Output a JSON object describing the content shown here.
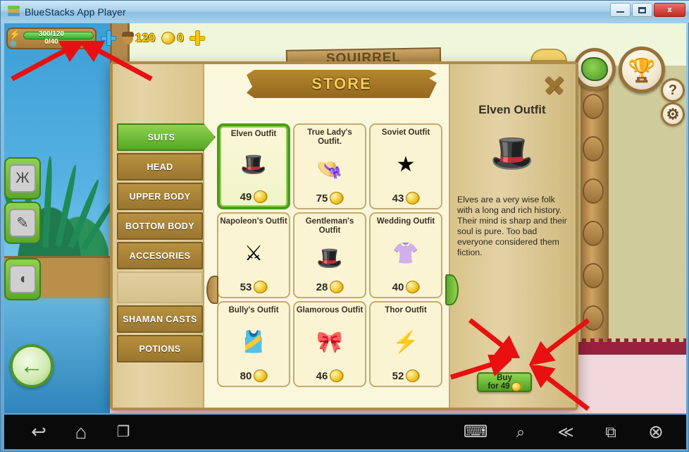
{
  "window": {
    "title": "BlueStacks App Player",
    "logo_icon": "bluestacks-logo",
    "minimize_label": "",
    "maximize_label": "",
    "close_label": "x"
  },
  "hud": {
    "energy_top": "300/120",
    "energy_bottom": "0/40",
    "acorn_count": "120",
    "coin_count": "0",
    "add_energy_icon": "blue-plus-icon",
    "add_coins_icon": "gold-plus-icon"
  },
  "game_banner": "SQUIRREL",
  "side_buttons": {
    "map_icon": "map-island-icon",
    "trophy_icon": "trophy-icon",
    "help_label": "?",
    "gear_icon": "gear-icon"
  },
  "inventory": [
    {
      "icon": "butterfly-icon",
      "glyph": "Ж"
    },
    {
      "icon": "feather-icon",
      "glyph": "✎"
    },
    {
      "icon": "squirrel-icon",
      "glyph": "◖"
    }
  ],
  "back_button_icon": "back-arrow-icon",
  "store": {
    "title": "STORE",
    "close_icon": "close-x-icon",
    "prev_page_icon": "prev-page-arrow",
    "next_page_icon": "next-page-arrow",
    "tabs": [
      {
        "label": "SUITS",
        "active": true
      },
      {
        "label": "HEAD",
        "active": false
      },
      {
        "label": "UPPER BODY",
        "active": false
      },
      {
        "label": "BOTTOM BODY",
        "active": false
      },
      {
        "label": "ACCESORIES",
        "active": false
      },
      {
        "label": "SHAMAN CASTS",
        "active": false
      },
      {
        "label": "POTIONS",
        "active": false
      }
    ],
    "items": [
      {
        "name": "Elven Outfit",
        "price": "49",
        "glyph": "🎩",
        "selected": true
      },
      {
        "name": "True Lady's Outfit.",
        "price": "75",
        "glyph": "👒",
        "selected": false
      },
      {
        "name": "Soviet Outfit",
        "price": "43",
        "glyph": "★",
        "selected": false
      },
      {
        "name": "Napoleon's Outfit",
        "price": "53",
        "glyph": "⚔",
        "selected": false
      },
      {
        "name": "Gentleman's Outfit",
        "price": "28",
        "glyph": "🎩",
        "selected": false
      },
      {
        "name": "Wedding Outfit",
        "price": "40",
        "glyph": "👚",
        "selected": false
      },
      {
        "name": "Bully's Outfit",
        "price": "80",
        "glyph": "🎽",
        "selected": false
      },
      {
        "name": "Glamorous Outfit",
        "price": "46",
        "glyph": "🎀",
        "selected": false
      },
      {
        "name": "Thor Outfit",
        "price": "52",
        "glyph": "⚡",
        "selected": false
      }
    ],
    "detail": {
      "title": "Elven Outfit",
      "thumb_icon": "elven-outfit-icon",
      "description": "Elves are a very wise folk with a long and rich history. Their mind is sharp and their soul is pure. Too bad everyone considered them fiction.",
      "buy_line1": "Buy",
      "buy_line2": "for 49"
    }
  },
  "navbar": {
    "left": [
      {
        "icon": "back-icon",
        "glyph": "↩"
      },
      {
        "icon": "home-icon",
        "glyph": "⌂"
      },
      {
        "icon": "recents-icon",
        "glyph": "❐"
      }
    ],
    "right": [
      {
        "icon": "keyboard-icon",
        "glyph": "⌨"
      },
      {
        "icon": "location-icon",
        "glyph": "⌕"
      },
      {
        "icon": "share-icon",
        "glyph": "≪"
      },
      {
        "icon": "screenshot-icon",
        "glyph": "⧉"
      },
      {
        "icon": "close-app-icon",
        "glyph": "⊗"
      }
    ]
  },
  "annotations": {
    "arrow_color": "#e81010",
    "count": 7
  }
}
